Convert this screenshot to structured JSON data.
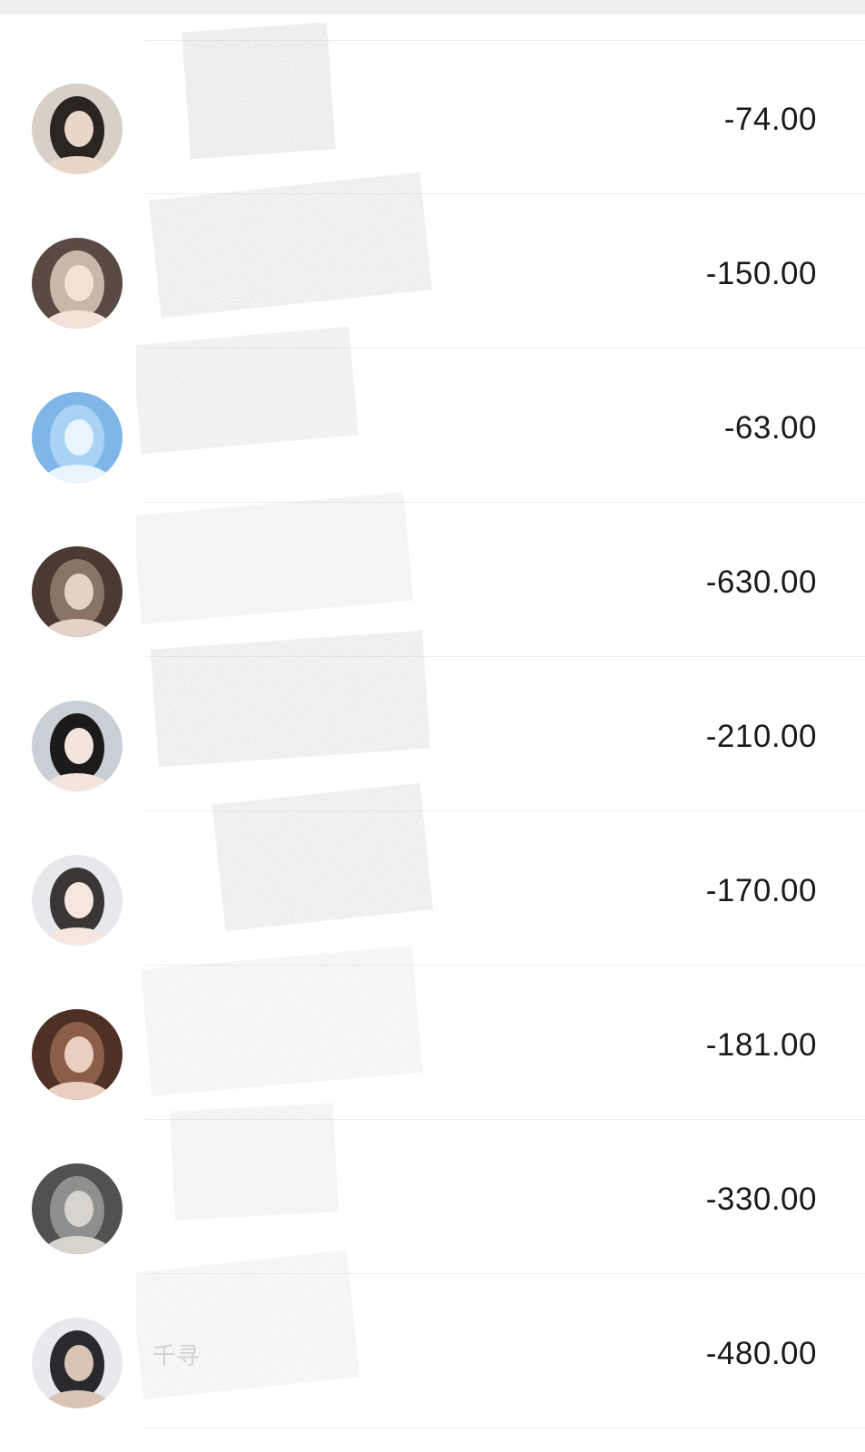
{
  "transactions": [
    {
      "amount": "-74.00",
      "title": "",
      "subtitle": "",
      "avatar_colors": [
        "#d8cfc6",
        "#2b2521",
        "#e9d6c8"
      ]
    },
    {
      "amount": "-150.00",
      "title": "",
      "subtitle": "",
      "avatar_colors": [
        "#5a4a44",
        "#c9b7ab",
        "#f2e2d8"
      ]
    },
    {
      "amount": "-63.00",
      "title": "",
      "subtitle": "",
      "avatar_colors": [
        "#7fb6e8",
        "#a9d2f5",
        "#e8f4ff"
      ]
    },
    {
      "amount": "-630.00",
      "title": "",
      "subtitle": "",
      "avatar_colors": [
        "#4a3a32",
        "#8a7468",
        "#e2d2c8"
      ]
    },
    {
      "amount": "-210.00",
      "title": "",
      "subtitle": "",
      "avatar_colors": [
        "#c8cfd6",
        "#1c1a1a",
        "#f3e4dc"
      ]
    },
    {
      "amount": "-170.00",
      "title": "",
      "subtitle": "",
      "avatar_colors": [
        "#e6e8ee",
        "#3a3636",
        "#f5e6e0"
      ]
    },
    {
      "amount": "-181.00",
      "title": "",
      "subtitle": "",
      "avatar_colors": [
        "#4e3026",
        "#8c5e48",
        "#e8cfc0"
      ]
    },
    {
      "amount": "-330.00",
      "title": "",
      "subtitle": "",
      "avatar_colors": [
        "#4f5250",
        "#8d908c",
        "#d8d4cc"
      ]
    },
    {
      "amount": "-480.00",
      "title": "千寻",
      "subtitle": "",
      "avatar_colors": [
        "#e7e9ef",
        "#2a2a2e",
        "#d9c4b6"
      ]
    }
  ]
}
